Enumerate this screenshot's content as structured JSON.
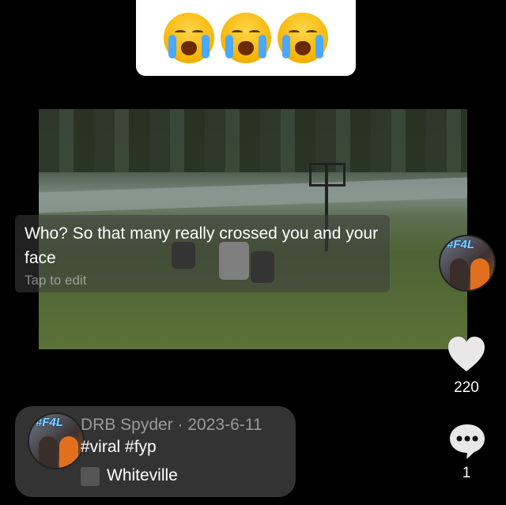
{
  "sticker": {
    "emojis": [
      "loudly-crying-face",
      "loudly-crying-face",
      "loudly-crying-face"
    ]
  },
  "caption": {
    "text": "Who? So that many really crossed you and your face",
    "hint": "Tap to edit"
  },
  "profile": {
    "avatar_tag": "#F4L"
  },
  "actions": {
    "like_count": "220",
    "comment_count": "1"
  },
  "post": {
    "author_line": "DRB Spyder · 2023-6-11",
    "hashtags": "#viral #fyp",
    "location": "Whiteville"
  }
}
